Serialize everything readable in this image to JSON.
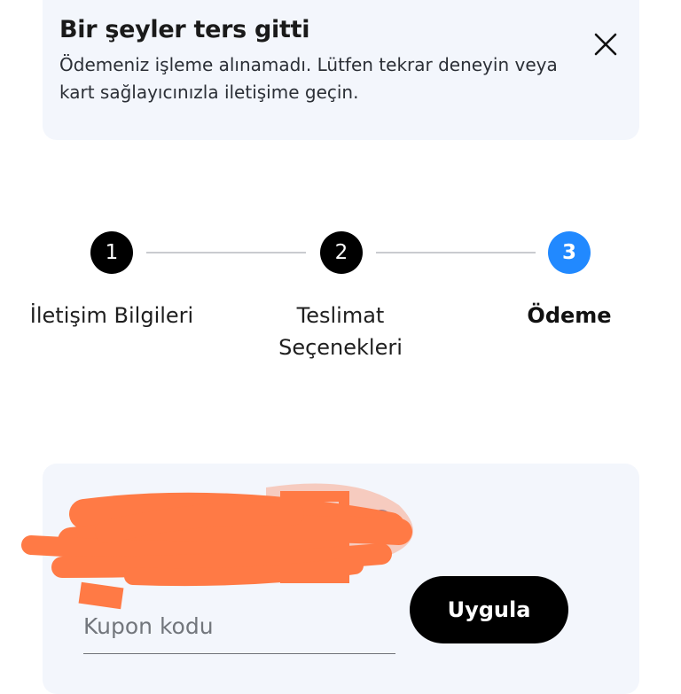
{
  "alert": {
    "title": "Bir şeyler ters gitti",
    "message_line1": "Ödemeniz işleme alınamadı. Lütfen tekrar deneyin veya",
    "message_line2": "kart sağlayıcınızla iletişime geçin.",
    "close_icon": "close-icon"
  },
  "stepper": {
    "steps": [
      {
        "number": "1",
        "label_line1": "İletişim Bilgileri",
        "label_line2": "",
        "state": "completed"
      },
      {
        "number": "2",
        "label_line1": "Teslimat",
        "label_line2": "Seçenekleri",
        "state": "completed"
      },
      {
        "number": "3",
        "label_line1": "Ödeme",
        "label_line2": "",
        "state": "active"
      }
    ],
    "colors": {
      "completed": "#000000",
      "active": "#2189ff",
      "connector": "#c9cbd0"
    }
  },
  "coupon": {
    "placeholder": "Kupon kodu",
    "value": "",
    "apply_label": "Uygula",
    "redaction_color": "#ff7a45"
  }
}
